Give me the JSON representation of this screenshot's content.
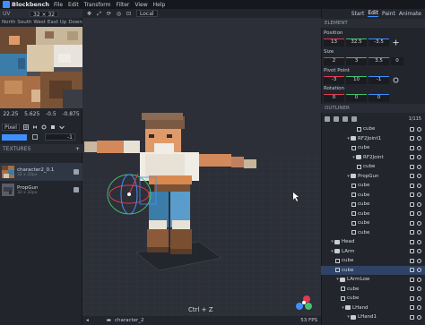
{
  "app": {
    "name": "Blockbench"
  },
  "menu": [
    "File",
    "Edit",
    "Transform",
    "Filter",
    "View",
    "Help"
  ],
  "uv_panel": {
    "title": "UV",
    "size": "32 × 32",
    "faces": [
      "North",
      "South",
      "West",
      "East",
      "Up",
      "Down"
    ],
    "axis_hint": "xy",
    "coords": [
      "22.25",
      "5.625",
      "-0.5",
      "-0.875"
    ],
    "brush_mode": "Pixel",
    "opacity_value": "-1"
  },
  "textures": {
    "title": "TEXTURES",
    "add_icon": "plus-icon",
    "items": [
      {
        "name": "character2_0.1",
        "size": "32 x 32px",
        "selected": true
      },
      {
        "name": "PropGun",
        "size": "32 x 32px",
        "selected": false
      }
    ]
  },
  "toolbar": {
    "space_mode": "Local",
    "icons": [
      "move-icon",
      "resize-icon",
      "rotate-icon",
      "pivot-icon",
      "vertex-snap-icon"
    ]
  },
  "viewport": {
    "undo_hint": "Ctrl + Z",
    "model_name": "character_2",
    "fps": "53 FPS"
  },
  "modes": {
    "items": [
      "Start",
      "Edit",
      "Paint",
      "Animate"
    ],
    "active": "Edit"
  },
  "element": {
    "title": "ELEMENT",
    "position_label": "Position",
    "position": [
      "13",
      "32.5",
      "-3.5"
    ],
    "size_label": "Size",
    "size": [
      "2",
      "3",
      "3.5"
    ],
    "size_extra": "0",
    "pivot_label": "Pivot Point",
    "pivot": [
      "-3",
      "10",
      "-1"
    ],
    "rotation_label": "Rotation",
    "rotation": [
      "0",
      "0",
      "0"
    ]
  },
  "outliner": {
    "title": "OUTLINER",
    "count": "1/115",
    "rows": [
      {
        "name": "cube",
        "type": "cube",
        "depth": 6,
        "selected": false
      },
      {
        "name": "RF2Joint1",
        "type": "group",
        "depth": 4,
        "selected": false
      },
      {
        "name": "cube",
        "type": "cube",
        "depth": 5,
        "selected": false
      },
      {
        "name": "RF2Joint",
        "type": "group",
        "depth": 5,
        "selected": false
      },
      {
        "name": "cube",
        "type": "cube",
        "depth": 6,
        "selected": false
      },
      {
        "name": "PropGun",
        "type": "group",
        "depth": 4,
        "selected": false
      },
      {
        "name": "cube",
        "type": "cube",
        "depth": 5,
        "selected": false
      },
      {
        "name": "cube",
        "type": "cube",
        "depth": 5,
        "selected": false
      },
      {
        "name": "cube",
        "type": "cube",
        "depth": 5,
        "selected": false
      },
      {
        "name": "cube",
        "type": "cube",
        "depth": 5,
        "selected": false
      },
      {
        "name": "cube",
        "type": "cube",
        "depth": 5,
        "selected": false
      },
      {
        "name": "cube",
        "type": "cube",
        "depth": 5,
        "selected": false
      },
      {
        "name": "Head",
        "type": "group",
        "depth": 1,
        "selected": false
      },
      {
        "name": "LArm",
        "type": "group",
        "depth": 1,
        "selected": false
      },
      {
        "name": "cube",
        "type": "cube",
        "depth": 2,
        "selected": false
      },
      {
        "name": "cube",
        "type": "cube",
        "depth": 2,
        "selected": true
      },
      {
        "name": "LArmLow",
        "type": "group",
        "depth": 2,
        "selected": false
      },
      {
        "name": "cube",
        "type": "cube",
        "depth": 3,
        "selected": false
      },
      {
        "name": "cube",
        "type": "cube",
        "depth": 3,
        "selected": false
      },
      {
        "name": "LHand",
        "type": "group",
        "depth": 3,
        "selected": false
      },
      {
        "name": "LHand1",
        "type": "group",
        "depth": 4,
        "selected": false
      }
    ]
  },
  "colors": {
    "accent": "#3e90ff",
    "selected_row": "#2f4366",
    "axis_x": "#e03a53",
    "axis_y": "#44c06e",
    "axis_z": "#3e90ff"
  }
}
